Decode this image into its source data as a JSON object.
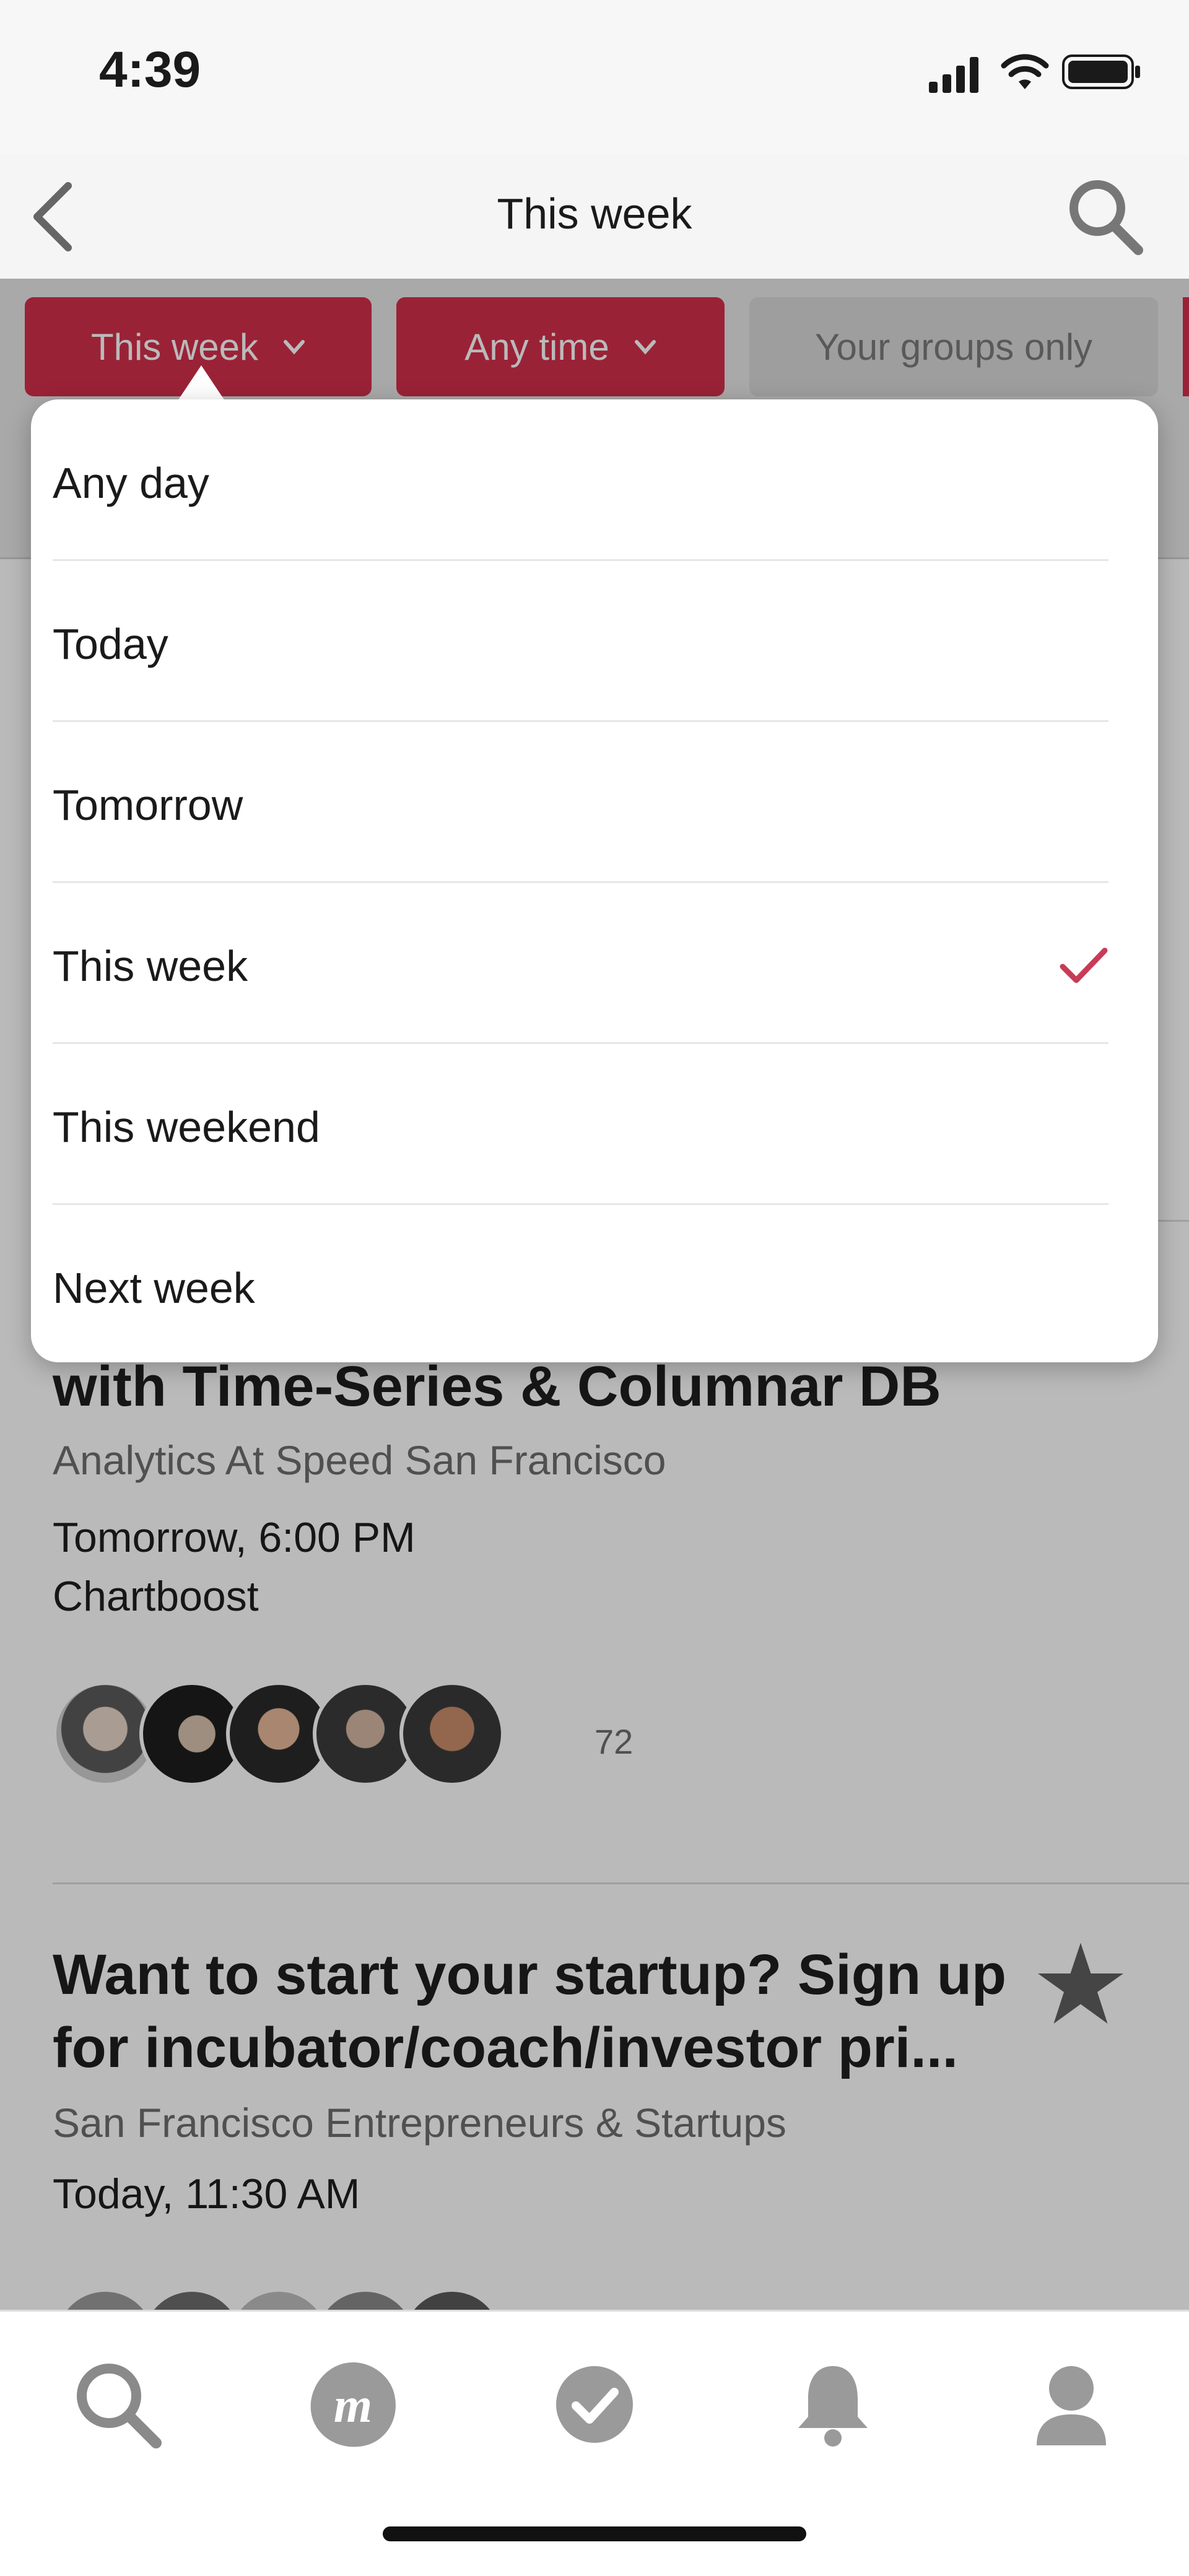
{
  "status_bar": {
    "time": "4:39"
  },
  "nav": {
    "title": "This week"
  },
  "filters": {
    "day_label": "This week",
    "time_label": "Any time",
    "groups_label": "Your groups only"
  },
  "dropdown": {
    "options": [
      {
        "label": "Any day"
      },
      {
        "label": "Today"
      },
      {
        "label": "Tomorrow"
      },
      {
        "label": "This week",
        "selected": true
      },
      {
        "label": "This weekend"
      },
      {
        "label": "Next week"
      }
    ],
    "accent_color": "#d32f4c"
  },
  "events": [
    {
      "title_visible": "with Time-Series & Columnar DB",
      "group": "Analytics At Speed San Francisco",
      "when": "Tomorrow, 6:00 PM",
      "where": "Chartboost",
      "attendee_count": "72"
    },
    {
      "title_line1": "Want to start your startup? Sign up",
      "title_line2": "for incubator/coach/investor pri...",
      "group": "San Francisco Entrepreneurs & Startups",
      "when": "Today, 11:30 AM"
    }
  ],
  "tabbar": {
    "items": [
      {
        "icon": "search-icon"
      },
      {
        "icon": "meetup-logo-icon"
      },
      {
        "icon": "check-circle-icon"
      },
      {
        "icon": "bell-icon"
      },
      {
        "icon": "profile-icon"
      }
    ]
  }
}
